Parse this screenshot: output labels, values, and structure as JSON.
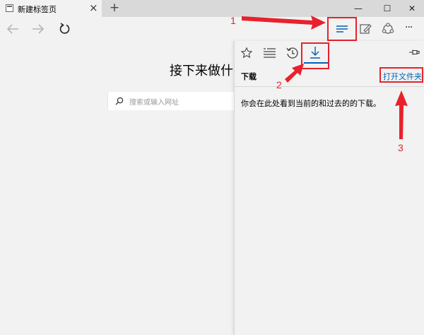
{
  "tab": {
    "title": "新建标签页",
    "close_glyph": "×"
  },
  "new_tab_glyph": "+",
  "window_controls": {
    "minimize": "—",
    "maximize": "☐",
    "close": "✕"
  },
  "toolbar": {
    "more_glyph": "···"
  },
  "page": {
    "headline": "接下来做什",
    "search_placeholder": "搜索或输入网址"
  },
  "hub": {
    "active_tab": "downloads",
    "tabs": [
      "favorites-icon",
      "reading-list-icon",
      "history-icon",
      "downloads-icon"
    ],
    "heading": "下载",
    "open_folder": "打开文件夹",
    "empty_message": "你会在此处看到当前的和过去的的下载。"
  },
  "annotations": {
    "callouts": [
      "1",
      "2",
      "3"
    ],
    "color": "#e8212c"
  },
  "colors": {
    "accent": "#0063b1",
    "annotation": "#e8212c"
  }
}
